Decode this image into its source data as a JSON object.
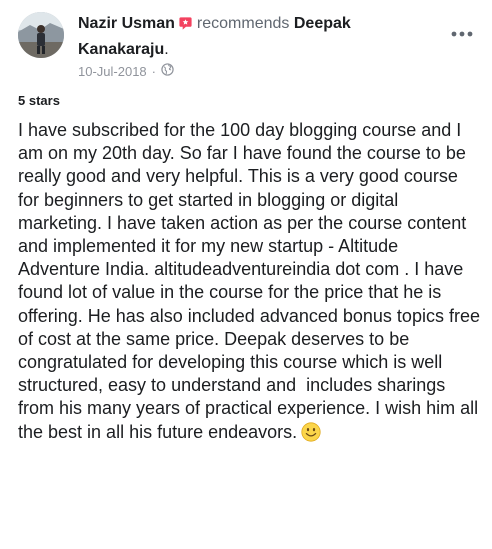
{
  "post": {
    "author": "Nazir Usman",
    "verb": "recommends",
    "target": "Deepak Kanakaraju",
    "target_suffix": ".",
    "date": "10-Jul-2018",
    "separator": "·",
    "privacy_icon": "globe-icon",
    "recommend_icon": "recommend-icon",
    "more_icon": "more-options-icon",
    "rating_label": "5 stars",
    "review_text": "I have subscribed for the 100 day blogging course and I am on my 20th day. So far I have found the course to be really good and very helpful. This is a very good course for beginners to get started in blogging or digital marketing. I have taken action as per the course content and implemented it for my new startup - Altitude Adventure India. altitudeadventureindia dot com . I have found lot of value in the course for the price that he is offering. He has also included advanced bonus topics free of cost at the same price. Deepak deserves to be congratulated for developing this course which is well structured, easy to understand and  includes sharings from his many years of practical experience. I wish him all the best in all his future endeavors.",
    "emoji_icon": "smiley-icon"
  },
  "colors": {
    "text": "#1c1e21",
    "secondary": "#606770",
    "muted": "#90949c",
    "recommend": "#f3425f"
  }
}
